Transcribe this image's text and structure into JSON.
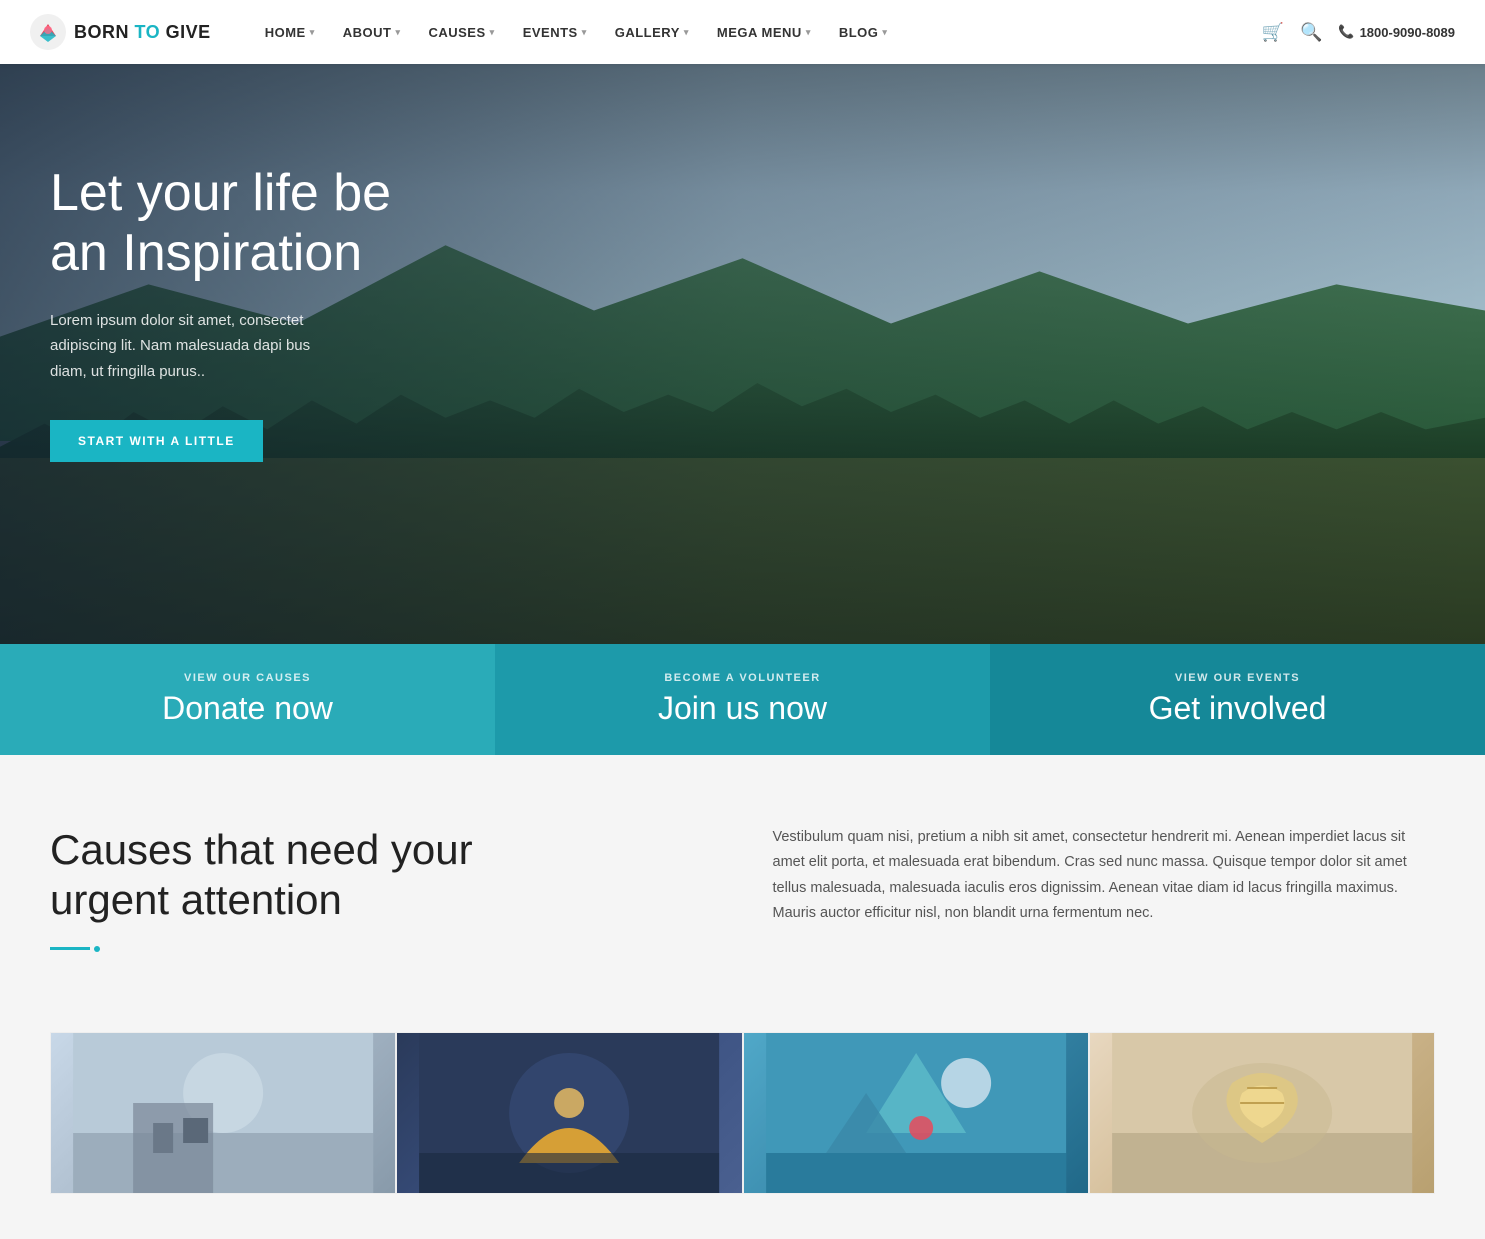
{
  "nav": {
    "logo_text_born": "BORN ",
    "logo_text_to": "TO",
    "logo_text_give": " GIVE",
    "links": [
      {
        "label": "HOME",
        "has_arrow": true
      },
      {
        "label": "ABOUT",
        "has_arrow": true
      },
      {
        "label": "CAUSES",
        "has_arrow": true
      },
      {
        "label": "EVENTS",
        "has_arrow": true
      },
      {
        "label": "GALLERY",
        "has_arrow": true
      },
      {
        "label": "MEGA MENU",
        "has_arrow": true
      },
      {
        "label": "BLOG",
        "has_arrow": true
      }
    ],
    "phone": "1800-9090-8089"
  },
  "hero": {
    "title": "Let your life be an Inspiration",
    "subtitle": "Lorem ipsum dolor sit amet, consectet adipiscing lit. Nam malesuada dapi bus diam, ut fringilla purus..",
    "cta_label": "START WITH A LITTLE"
  },
  "banner": {
    "cells": [
      {
        "label": "VIEW OUR CAUSES",
        "title": "Donate now"
      },
      {
        "label": "BECOME A VOLUNTEER",
        "title": "Join us now"
      },
      {
        "label": "VIEW OUR EVENTS",
        "title": "Get involved"
      }
    ]
  },
  "main": {
    "section_heading_line1": "Causes that need your",
    "section_heading_line2": "urgent attention",
    "section_body": "Vestibulum quam nisi, pretium a nibh sit amet, consectetur hendrerit mi. Aenean imperdiet lacus sit amet elit porta, et malesuada erat bibendum. Cras sed nunc massa. Quisque tempor dolor sit amet tellus malesuada, malesuada iaculis eros dignissim. Aenean vitae diam id lacus fringilla maximus. Mauris auctor efficitur nisl, non blandit urna fermentum nec."
  }
}
